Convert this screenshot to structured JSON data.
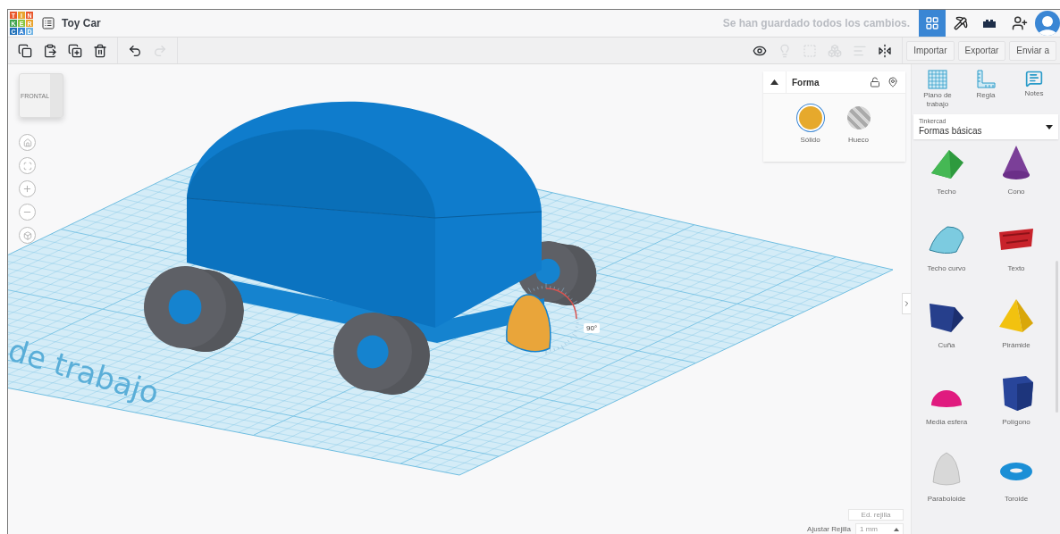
{
  "document": {
    "title": "Toy Car"
  },
  "logo": [
    "T",
    "I",
    "N",
    "K",
    "E",
    "R",
    "C",
    "A",
    "D"
  ],
  "save_status": "Se han guardado todos los cambios.",
  "apps": [
    {
      "kind": "grid",
      "selected": true
    },
    {
      "kind": "pickaxe",
      "selected": false
    },
    {
      "kind": "bricks",
      "selected": false
    }
  ],
  "edit_tools": [
    {
      "kind": "copy",
      "disabled": false
    },
    {
      "kind": "paste",
      "disabled": false
    },
    {
      "kind": "duplicate",
      "disabled": false
    },
    {
      "kind": "delete",
      "disabled": false
    },
    {
      "kind": "undo",
      "disabled": false
    },
    {
      "kind": "redo",
      "disabled": true
    }
  ],
  "view_tools": [
    {
      "kind": "notes-toggle",
      "disabled": false
    },
    {
      "kind": "bulb",
      "disabled": true
    },
    {
      "kind": "group",
      "disabled": true
    },
    {
      "kind": "ungroup",
      "disabled": true
    },
    {
      "kind": "align",
      "disabled": true
    },
    {
      "kind": "mirror",
      "disabled": false
    }
  ],
  "actions": [
    "Importar",
    "Exportar",
    "Enviar a"
  ],
  "view_cube": {
    "front": "FRONTAL"
  },
  "workplane_label": "de trabajo",
  "rotation_label": "90°",
  "inspector": {
    "title": "Forma",
    "options": [
      {
        "label": "Sólido",
        "kind": "solid",
        "selected": true
      },
      {
        "label": "Hueco",
        "kind": "hole",
        "selected": false
      }
    ]
  },
  "grid_controls": {
    "edit_button": "Ed. rejilla",
    "snap_label": "Ajustar Rejilla",
    "snap_value": "1 mm"
  },
  "panel_tools": [
    {
      "label": "Plano de trabajo",
      "kind": "workplane"
    },
    {
      "label": "Regla",
      "kind": "ruler"
    },
    {
      "label": "Notes",
      "kind": "notes"
    }
  ],
  "library": {
    "caption": "Tinkercad",
    "value": "Formas básicas"
  },
  "shapes": [
    {
      "label": "Techo",
      "kind": "roof"
    },
    {
      "label": "Cono",
      "kind": "cone"
    },
    {
      "label": "Techo curvo",
      "kind": "round-roof"
    },
    {
      "label": "Texto",
      "kind": "text"
    },
    {
      "label": "Cuña",
      "kind": "wedge"
    },
    {
      "label": "Pirámide",
      "kind": "pyramid"
    },
    {
      "label": "Media esfera",
      "kind": "half-sphere"
    },
    {
      "label": "Polígono",
      "kind": "polygon"
    },
    {
      "label": "Paraboloide",
      "kind": "paraboloid"
    },
    {
      "label": "Toroide",
      "kind": "torus"
    }
  ]
}
